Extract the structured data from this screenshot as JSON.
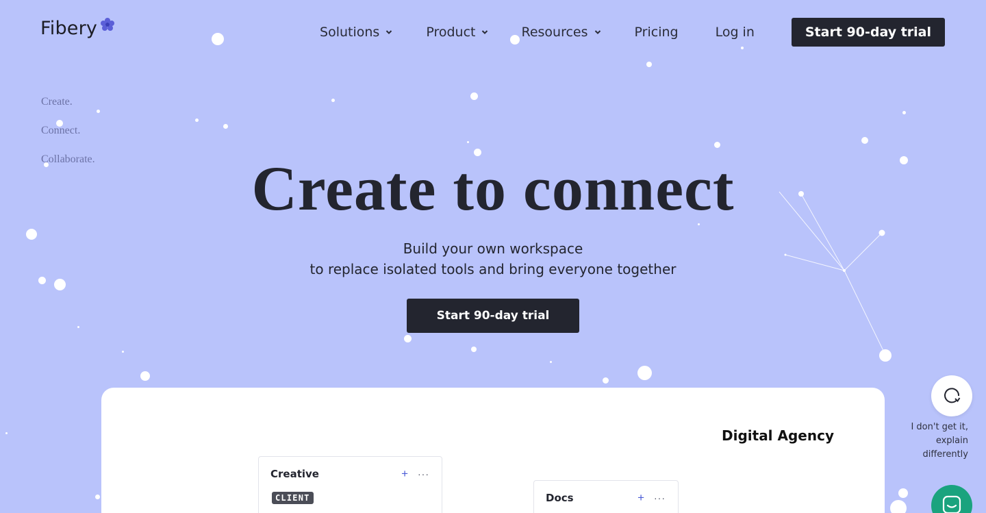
{
  "brand": {
    "name": "Fibery",
    "mark_color": "#5b5fd8"
  },
  "nav": {
    "solutions": "Solutions",
    "product": "Product",
    "resources": "Resources",
    "pricing": "Pricing",
    "login": "Log in",
    "cta": "Start 90-day trial"
  },
  "side_words": [
    "Create.",
    "Connect.",
    "Collaborate."
  ],
  "hero": {
    "title": "Create to connect",
    "subtitle_line1": "Build your own workspace",
    "subtitle_line2": "to replace isolated tools and bring everyone together",
    "cta": "Start 90-day trial"
  },
  "demo": {
    "title": "Digital Agency",
    "boards": [
      {
        "name": "Creative",
        "add": "+",
        "more": "···",
        "tag": "CLIENT"
      },
      {
        "name": "Docs",
        "add": "+",
        "more": "···"
      }
    ]
  },
  "help": {
    "text_line1": "I don't get it,",
    "text_line2": "explain",
    "text_line3": "differently"
  },
  "colors": {
    "background": "#b9c3fb",
    "dark": "#23252f",
    "accent": "#4a5bd6",
    "chat": "#1aa37e"
  },
  "icons": {
    "nav_dropdown": "chevron-down-icon",
    "help": "refresh-icon",
    "chat": "chat-icon"
  }
}
